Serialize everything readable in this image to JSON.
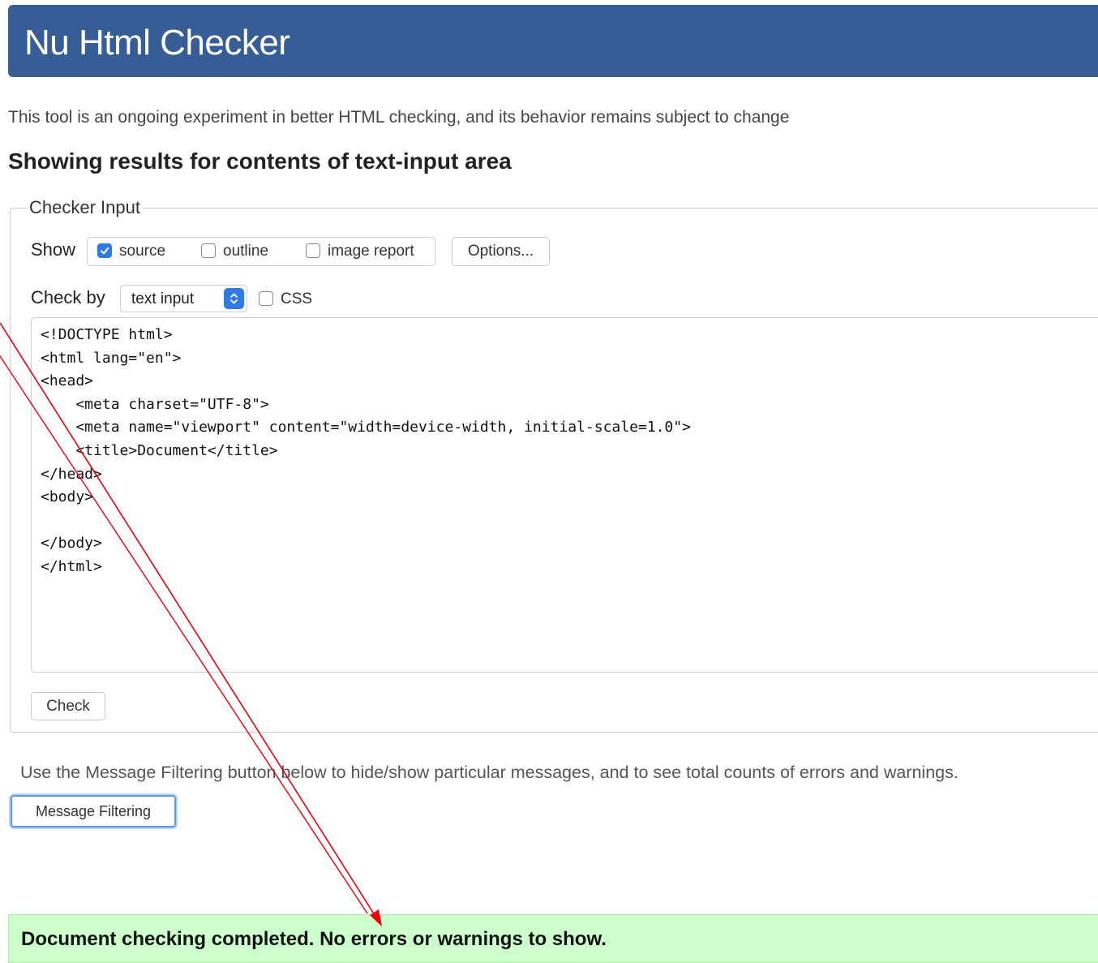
{
  "header": {
    "title": "Nu Html Checker"
  },
  "intro_text": "This tool is an ongoing experiment in better HTML checking, and its behavior remains subject to change",
  "results_heading": "Showing results for contents of text-input area",
  "checker_input": {
    "legend": "Checker Input",
    "show_label": "Show",
    "show_options": [
      {
        "label": "source",
        "checked": true
      },
      {
        "label": "outline",
        "checked": false
      },
      {
        "label": "image report",
        "checked": false
      }
    ],
    "options_button": "Options...",
    "check_by_label": "Check by",
    "check_by_value": "text input",
    "css_option": {
      "label": "CSS",
      "checked": false
    },
    "source_text": "<!DOCTYPE html>\n<html lang=\"en\">\n<head>\n    <meta charset=\"UTF-8\">\n    <meta name=\"viewport\" content=\"width=device-width, initial-scale=1.0\">\n    <title>Document</title>\n</head>\n<body>\n\n</body>\n</html>",
    "check_button": "Check"
  },
  "filter_note": "Use the Message Filtering button below to hide/show particular messages, and to see total counts of errors and warnings.",
  "filter_button": "Message Filtering",
  "result_message": "Document checking completed. No errors or warnings to show.",
  "colors": {
    "header_bg": "#365d95",
    "success_bg": "#ccffcc",
    "accent_blue": "#2f7be5",
    "annotation_red": "#e8000b"
  },
  "icons": {
    "checkmark": "check-icon",
    "select_arrows": "updown-chevron-icon",
    "annotation": "red-arrow-annotation"
  }
}
